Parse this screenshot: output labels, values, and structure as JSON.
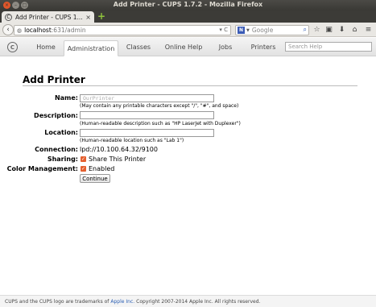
{
  "window": {
    "title": "Add Printer - CUPS 1.7.2 - Mozilla Firefox"
  },
  "tabs": [
    {
      "title": "Add Printer - CUPS 1...",
      "close": "×"
    }
  ],
  "new_tab_label": "+",
  "nav": {
    "back_icon": "‹",
    "url_host": "localhost",
    "url_path": ":631/admin",
    "url_icons": "▾ C",
    "search_engine": "N",
    "search_placeholder": "Google",
    "search_icon": "⌕",
    "toolbar_icons": [
      "☆",
      "▣",
      "⬇",
      "⌂",
      "≡"
    ]
  },
  "cups": {
    "logo": "C",
    "tabs": [
      {
        "label": "Home"
      },
      {
        "label": "Administration",
        "active": true
      },
      {
        "label": "Classes"
      },
      {
        "label": "Online Help"
      },
      {
        "label": "Jobs"
      },
      {
        "label": "Printers"
      }
    ],
    "search_placeholder": "Search Help"
  },
  "form": {
    "heading": "Add Printer",
    "name_label": "Name:",
    "name_placeholder": "OurPrinter",
    "name_hint": "(May contain any printable characters except \"/\", \"#\", and space)",
    "description_label": "Description:",
    "description_value": "",
    "description_hint": "(Human-readable description such as \"HP LaserJet with Duplexer\")",
    "location_label": "Location:",
    "location_value": "",
    "location_hint": "(Human-readable location such as \"Lab 1\")",
    "connection_label": "Connection:",
    "connection_value": "lpd://10.100.64.32/9100",
    "sharing_label": "Sharing:",
    "sharing_option": "Share This Printer",
    "sharing_checked": true,
    "color_label": "Color Management:",
    "color_option": "Enabled",
    "color_checked": true,
    "continue_label": "Continue"
  },
  "footer": {
    "text_before": "CUPS and the CUPS logo are trademarks of",
    "link": "Apple Inc.",
    "text_after": "Copyright 2007-2014 Apple Inc. All rights reserved."
  },
  "colors": {
    "checkbox": "#e5602f",
    "close_button": "#e2562a",
    "link": "#2b5fb4"
  }
}
